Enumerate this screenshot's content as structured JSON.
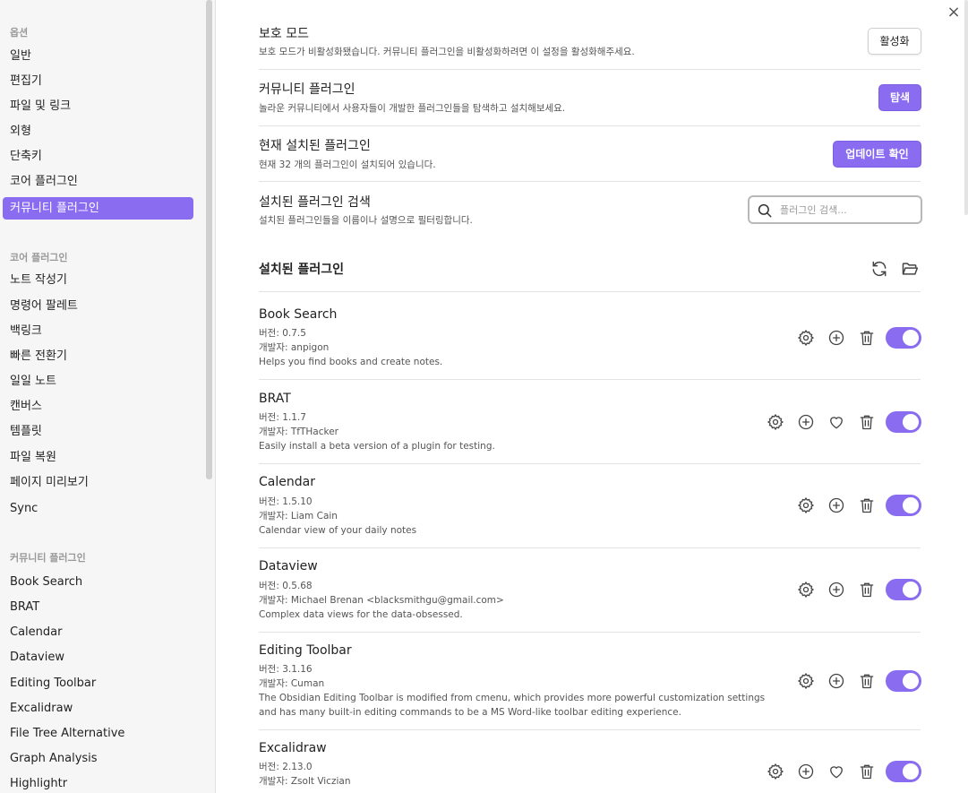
{
  "sidebar": {
    "sections": [
      {
        "header": "옵션",
        "items": [
          "일반",
          "편집기",
          "파일 및 링크",
          "외형",
          "단축키",
          "코어 플러그인",
          "커뮤니티 플러그인"
        ]
      },
      {
        "header": "코어 플러그인",
        "items": [
          "노트 작성기",
          "명령어 팔레트",
          "백링크",
          "빠른 전환기",
          "일일 노트",
          "캔버스",
          "템플릿",
          "파일 복원",
          "페이지 미리보기",
          "Sync"
        ]
      },
      {
        "header": "커뮤니티 플러그인",
        "items": [
          "Book Search",
          "BRAT",
          "Calendar",
          "Dataview",
          "Editing Toolbar",
          "Excalidraw",
          "File Tree Alternative",
          "Graph Analysis",
          "Highlightr"
        ]
      }
    ],
    "active_item": "커뮤니티 플러그인"
  },
  "close_label": "×",
  "settings": {
    "safe_mode": {
      "title": "보호 모드",
      "desc": "보호 모드가 비활성화됐습니다. 커뮤니티 플러그인을 비활성화하려면 이 설정을 활성화해주세요.",
      "button": "활성화"
    },
    "community": {
      "title": "커뮤니티 플러그인",
      "desc": "놀라운 커뮤니티에서 사용자들이 개발한 플러그인들을 탐색하고 설치해보세요.",
      "button": "탐색"
    },
    "installed": {
      "title": "현재 설치된 플러그인",
      "desc": "현재 32 개의 플러그인이 설치되어 있습니다.",
      "button": "업데이트 확인"
    },
    "search": {
      "title": "설치된 플러그인 검색",
      "desc": "설치된 플러그인들을 이름이나 설명으로 필터링합니다.",
      "placeholder": "플러그인 검색..."
    }
  },
  "installed_section": {
    "title": "설치된 플러그인",
    "icons": [
      "refresh-icon",
      "folder-open-icon"
    ]
  },
  "plugins": [
    {
      "name": "Book Search",
      "version": "버전: 0.7.5",
      "author": "개발자: anpigon",
      "desc": [
        "Helps you find books and create notes."
      ],
      "heart": false,
      "enabled": true
    },
    {
      "name": "BRAT",
      "version": "버전: 1.1.7",
      "author": "개발자: TfTHacker",
      "desc": [
        "Easily install a beta version of a plugin for testing."
      ],
      "heart": true,
      "enabled": true
    },
    {
      "name": "Calendar",
      "version": "버전: 1.5.10",
      "author": "개발자: Liam Cain",
      "desc": [
        "Calendar view of your daily notes"
      ],
      "heart": false,
      "enabled": true
    },
    {
      "name": "Dataview",
      "version": "버전: 0.5.68",
      "author": "개발자: Michael Brenan <blacksmithgu@gmail.com>",
      "desc": [
        "Complex data views for the data-obsessed."
      ],
      "heart": false,
      "enabled": true
    },
    {
      "name": "Editing Toolbar",
      "version": "버전: 3.1.16",
      "author": "개발자: Cuman",
      "desc": [
        "The Obsidian Editing Toolbar is modified from cmenu, which provides more powerful customization settings",
        "and has many built-in editing commands to be a MS Word-like toolbar editing experience."
      ],
      "heart": false,
      "enabled": true
    },
    {
      "name": "Excalidraw",
      "version": "버전: 2.13.0",
      "author": "개발자: Zsolt Viczian",
      "desc": [],
      "heart": true,
      "enabled": true
    }
  ]
}
